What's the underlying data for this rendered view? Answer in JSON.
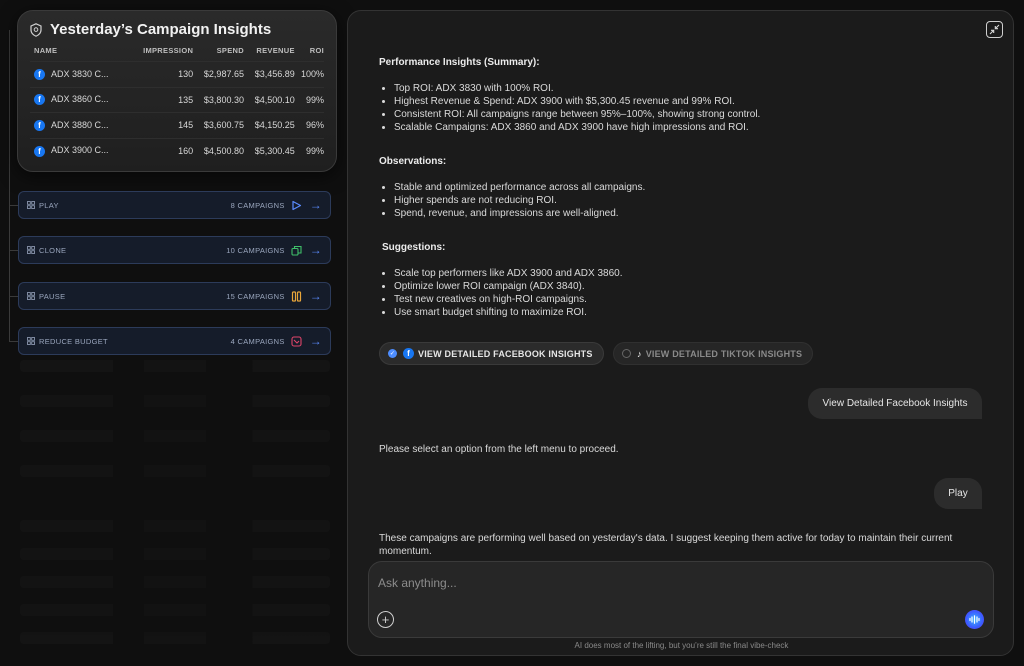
{
  "insights": {
    "title": "Yesterday’s Campaign Insights",
    "columns": [
      "NAME",
      "IMPRESSION",
      "SPEND",
      "REVENUE",
      "ROI"
    ],
    "rows": [
      {
        "name": "ADX 3830 C...",
        "impression": "130",
        "spend": "$2,987.65",
        "revenue": "$3,456.89",
        "roi": "100%"
      },
      {
        "name": "ADX 3860 C...",
        "impression": "135",
        "spend": "$3,800.30",
        "revenue": "$4,500.10",
        "roi": "99%"
      },
      {
        "name": "ADX 3880 C...",
        "impression": "145",
        "spend": "$3,600.75",
        "revenue": "$4,150.25",
        "roi": "96%"
      },
      {
        "name": "ADX 3900 C...",
        "impression": "160",
        "spend": "$4,500.80",
        "revenue": "$5,300.45",
        "roi": "99%"
      }
    ]
  },
  "actions": [
    {
      "label": "PLAY",
      "count": "8 CAMPAIGNS",
      "icon": "play-icon",
      "color": "#5b8cff"
    },
    {
      "label": "CLONE",
      "count": "10 CAMPAIGNS",
      "icon": "clone-icon",
      "color": "#3fbf6a"
    },
    {
      "label": "PAUSE",
      "count": "15 CAMPAIGNS",
      "icon": "pause-icon",
      "color": "#e8a53a"
    },
    {
      "label": "REDUCE BUDGET",
      "count": "4 CAMPAIGNS",
      "icon": "reduce-budget-icon",
      "color": "#e0456a"
    }
  ],
  "chat": {
    "summary_title": "Performance Insights (Summary):",
    "summary_items": [
      "Top ROI: ADX 3830 with 100% ROI.",
      "Highest Revenue & Spend: ADX 3900 with $5,300.45 revenue and 99% ROI.",
      "Consistent ROI: All campaigns range between 95%–100%, showing strong control.",
      "Scalable Campaigns: ADX 3860 and ADX 3900 have high impressions and ROI."
    ],
    "observations_title": "Observations:",
    "observations_items": [
      "Stable and optimized performance across all campaigns.",
      "Higher spends are not reducing ROI.",
      "Spend, revenue, and impressions are well-aligned."
    ],
    "suggestions_title": "Suggestions:",
    "suggestions_items": [
      "Scale top performers like ADX 3900 and ADX 3860.",
      "Optimize lower ROI campaign (ADX 3840).",
      "Test new creatives on high-ROI campaigns.",
      "Use smart budget shifting to maximize ROI."
    ],
    "option_facebook": "VIEW DETAILED FACEBOOK INSIGHTS",
    "option_tiktok": "VIEW DETAILED TIKTOK INSIGHTS",
    "user_msg_1": "View Detailed Facebook Insights",
    "bot_msg_1": "Please select an option from the left menu to proceed.",
    "user_msg_2": "Play",
    "bot_msg_2": "These campaigns are performing well based on yesterday's data. I suggest keeping them active for today to maintain their current momentum."
  },
  "composer": {
    "placeholder": "Ask anything...",
    "footer": "AI does most of the lifting, but you’re still the final vibe-check"
  }
}
